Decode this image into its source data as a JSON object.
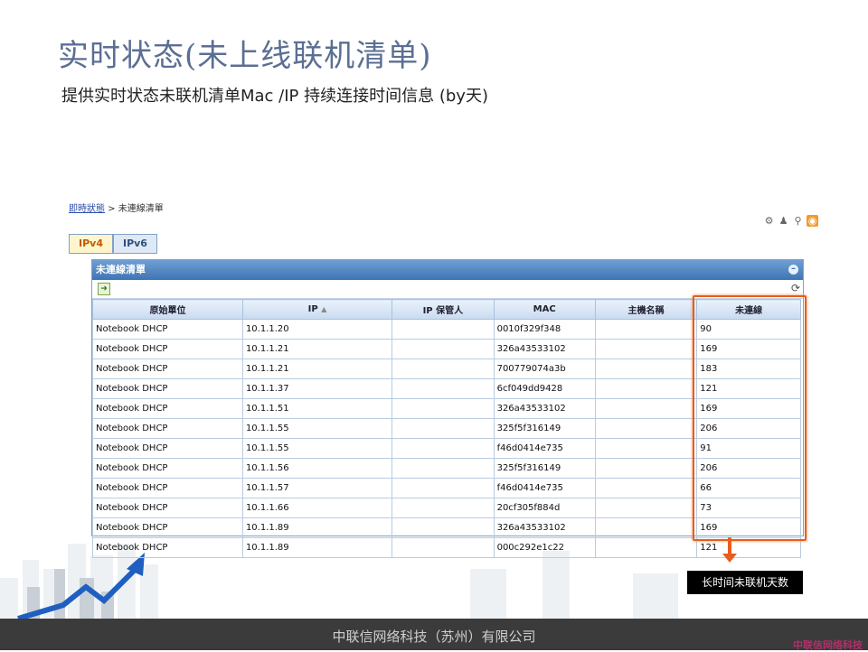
{
  "slide": {
    "title": "实时状态(未上线联机清单)",
    "subtitle": "提供实时状态未联机清单Mac /IP 持续连接时间信息 (by天)",
    "footer": "中联信网络科技（苏州）有限公司",
    "footer_brand": "中联信网络科技",
    "callout": "长时间未联机天数"
  },
  "app": {
    "breadcrumb": {
      "link": "即時狀態",
      "separator": " > ",
      "current": "未連線清單"
    },
    "tabs": [
      {
        "label": "IPv4"
      },
      {
        "label": "IPv6"
      }
    ],
    "panel_title": "未連線清單",
    "columns": [
      "原始單位",
      "IP",
      "IP 保管人",
      "MAC",
      "主機名稱",
      "未連線"
    ],
    "rows": [
      [
        "Notebook DHCP",
        "10.1.1.20",
        "",
        "0010f329f348",
        "",
        "90"
      ],
      [
        "Notebook DHCP",
        "10.1.1.21",
        "",
        "326a43533102",
        "",
        "169"
      ],
      [
        "Notebook DHCP",
        "10.1.1.21",
        "",
        "700779074a3b",
        "",
        "183"
      ],
      [
        "Notebook DHCP",
        "10.1.1.37",
        "",
        "6cf049dd9428",
        "",
        "121"
      ],
      [
        "Notebook DHCP",
        "10.1.1.51",
        "",
        "326a43533102",
        "",
        "169"
      ],
      [
        "Notebook DHCP",
        "10.1.1.55",
        "",
        "325f5f316149",
        "",
        "206"
      ],
      [
        "Notebook DHCP",
        "10.1.1.55",
        "",
        "f46d0414e735",
        "",
        "91"
      ],
      [
        "Notebook DHCP",
        "10.1.1.56",
        "",
        "325f5f316149",
        "",
        "206"
      ],
      [
        "Notebook DHCP",
        "10.1.1.57",
        "",
        "f46d0414e735",
        "",
        "66"
      ],
      [
        "Notebook DHCP",
        "10.1.1.66",
        "",
        "20cf305f884d",
        "",
        "73"
      ],
      [
        "Notebook DHCP",
        "10.1.1.89",
        "",
        "326a43533102",
        "",
        "169"
      ],
      [
        "Notebook DHCP",
        "10.1.1.89",
        "",
        "000c292e1c22",
        "",
        "121"
      ]
    ],
    "icons": [
      "gear-icon",
      "user-icon",
      "plug-icon",
      "rss-icon",
      "export-icon",
      "refresh-icon",
      "collapse-icon",
      "sort-ascending-icon"
    ],
    "colors": {
      "highlight": "#e95d1c",
      "header_blue": "#3f74b5",
      "title": "#5b6f93"
    }
  }
}
